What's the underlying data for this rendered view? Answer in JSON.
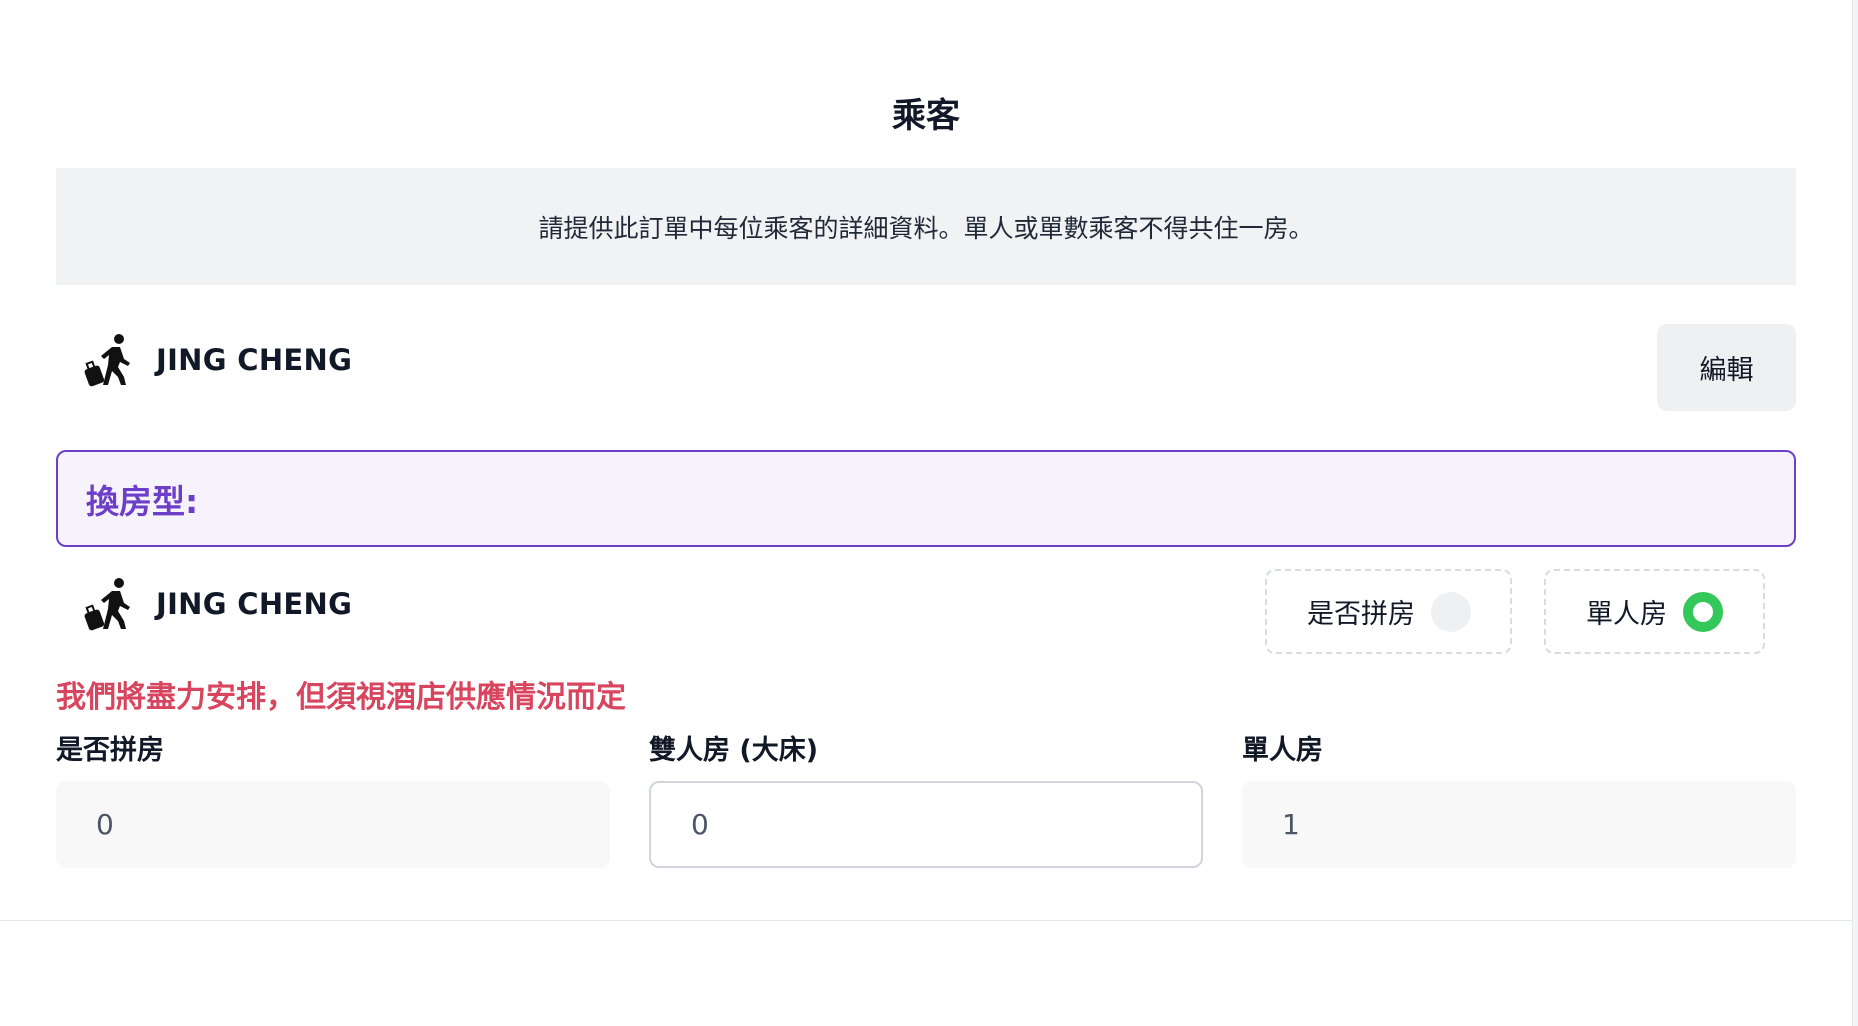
{
  "page_title": "乘客",
  "notice": "請提供此訂單中每位乘客的詳細資料。單人或單數乘客不得共住一房。",
  "passenger": {
    "name": "JING CHENG",
    "edit_label": "編輯"
  },
  "room_type": {
    "label": "換房型:",
    "passenger_name": "JING CHENG",
    "options": [
      {
        "label": "是否拼房",
        "selected": false
      },
      {
        "label": "單人房",
        "selected": true
      }
    ]
  },
  "warning": "我們將盡力安排，但須視酒店供應情況而定",
  "fields": [
    {
      "label": "是否拼房",
      "value": "0",
      "editable": false
    },
    {
      "label": "雙人房 (大床)",
      "value": "0",
      "editable": true
    },
    {
      "label": "單人房",
      "value": "1",
      "editable": false
    }
  ],
  "colors": {
    "accent_purple": "#6d3fc8",
    "warning_red": "#d7455e",
    "selected_green": "#34c759"
  },
  "icons": {
    "passenger": "traveler-with-luggage-icon"
  }
}
